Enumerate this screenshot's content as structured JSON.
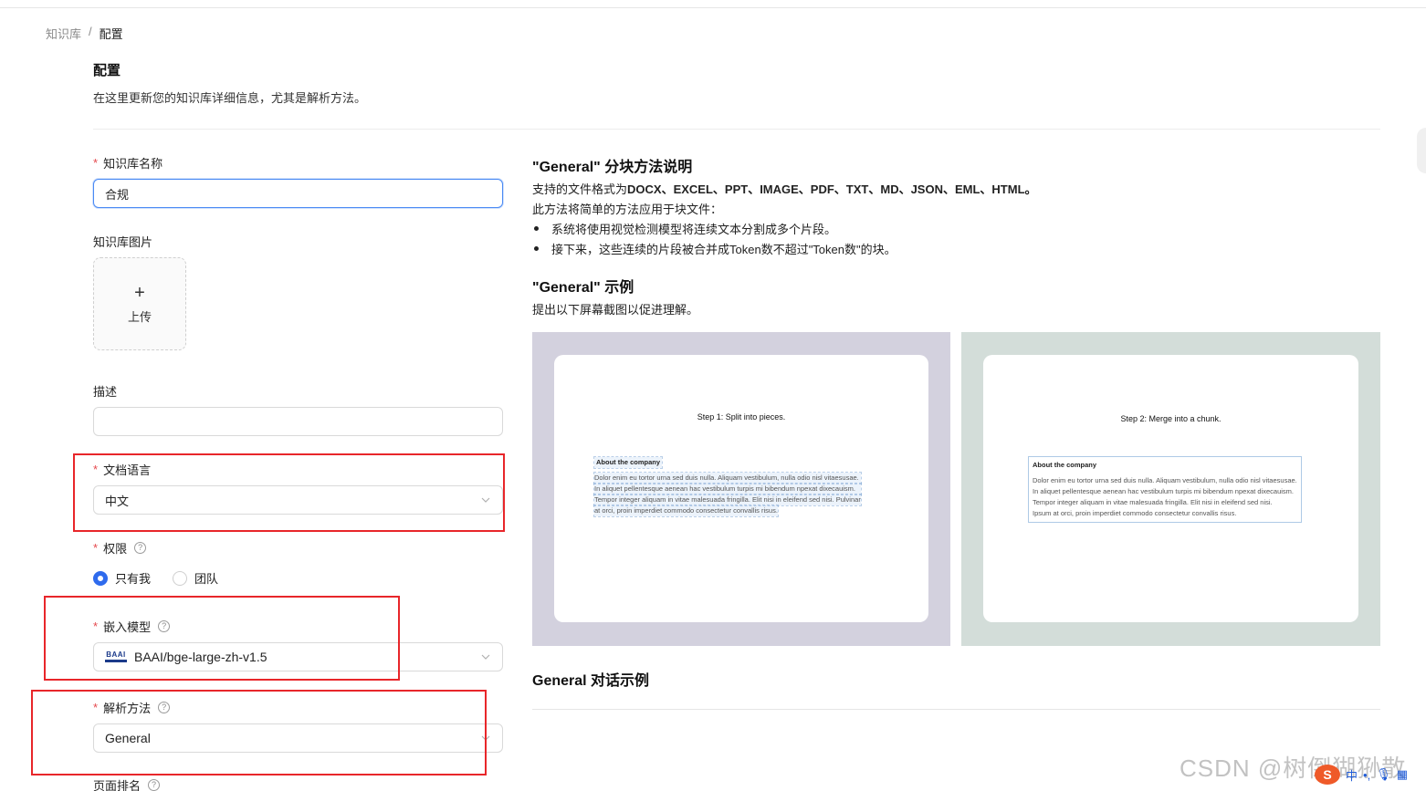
{
  "breadcrumb": {
    "parent": "知识库",
    "separator": "/",
    "current": "配置"
  },
  "header": {
    "title": "配置",
    "subtitle": "在这里更新您的知识库详细信息，尤其是解析方法。"
  },
  "form": {
    "name": {
      "label": "知识库名称",
      "value": "合规"
    },
    "image": {
      "label": "知识库图片",
      "upload_label": "上传"
    },
    "description": {
      "label": "描述",
      "value": ""
    },
    "language": {
      "label": "文档语言",
      "value": "中文"
    },
    "permission": {
      "label": "权限",
      "options": [
        "只有我",
        "团队"
      ],
      "selected": "只有我"
    },
    "embedding": {
      "label": "嵌入模型",
      "logo_text": "BAAI",
      "value": "BAAI/bge-large-zh-v1.5"
    },
    "parser": {
      "label": "解析方法",
      "value": "General"
    },
    "page_rank": {
      "label": "页面排名"
    }
  },
  "info": {
    "method_title": "\"General\" 分块方法说明",
    "formats_prefix": "支持的文件格式为",
    "formats": "DOCX、EXCEL、PPT、IMAGE、PDF、TXT、MD、JSON、EML、HTML。",
    "intro": "此方法将简单的方法应用于块文件：",
    "bullets": [
      "系统将使用视觉检测模型将连续文本分割成多个片段。",
      "接下来，这些连续的片段被合并成Token数不超过\"Token数\"的块。"
    ],
    "example_title": "\"General\" 示例",
    "example_desc": "提出以下屏幕截图以促进理解。",
    "dialog_title": "General 对话示例"
  },
  "examples": [
    {
      "step": "Step 1: Split into pieces.",
      "heading": "About the company",
      "lines": [
        "Dolor enim eu tortor urna sed duis nulla. Aliquam vestibulum, nulla odio nisl vitaesusae.",
        "In aliquet pellentesque aenean hac vestibulum turpis mi bibendum npexat dixecauism.",
        "Tempor integer aliquam in vitae malesuada fringilla. Elit nisi in eleifend sed nisi. Pulvinar",
        "at orci, proin imperdiet commodo consectetur convallis risus."
      ],
      "bg": "#d3d1de"
    },
    {
      "step": "Step 2: Merge into a chunk.",
      "heading": "About the company",
      "lines": [
        "Dolor enim eu tortor urna sed duis nulla. Aliquam vestibulum, nulla odio nisl vitaesusae.",
        "In aliquet pellentesque aenean hac vestibulum turpis mi bibendum npexat dixecauism.",
        "Tempor integer aliquam in vitae malesuada fringilla. Elit nisi in eleifend sed nisi.",
        "Ipsum at orci, proin imperdiet commodo consectetur convallis risus."
      ],
      "bg": "#d3ddd9"
    }
  ],
  "watermark": "CSDN @树倒猢狲散",
  "ime": {
    "lang": "中"
  },
  "colors": {
    "accent": "#2f6bed",
    "required": "#e5484d",
    "annotation": "#e8262a"
  }
}
